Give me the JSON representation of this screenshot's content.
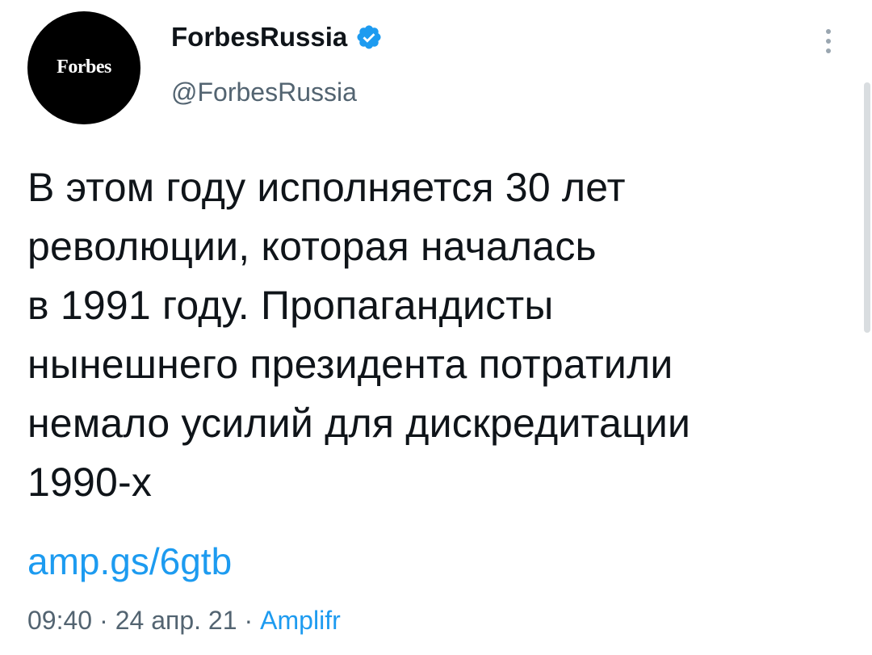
{
  "author": {
    "avatar_logo": "Forbes",
    "display_name": "ForbesRussia",
    "handle": "@ForbesRussia",
    "verified": true
  },
  "icons": {
    "verified": "verified-badge-icon",
    "more": "more-vertical-icon"
  },
  "tweet": {
    "text_lines": [
      "В этом году исполняется 30 лет",
      "революции, которая началась",
      "в 1991 году. Пропагандисты",
      "нынешнего президента потратили",
      "немало усилий для дискредитации",
      "1990-х"
    ],
    "link": "amp.gs/6gtb",
    "time": "09:40",
    "date": "24 апр. 21",
    "source": "Amplifr",
    "separator": "·"
  },
  "colors": {
    "link": "#1d9bf0",
    "secondary_text": "#536471",
    "avatar_bg": "#000000"
  }
}
